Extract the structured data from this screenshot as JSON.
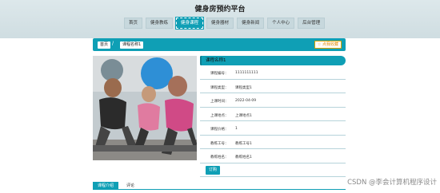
{
  "site_title": "健身房预约平台",
  "nav": [
    {
      "label": "首页"
    },
    {
      "label": "健身教练"
    },
    {
      "label": "健身课程"
    },
    {
      "label": "健身器材"
    },
    {
      "label": "健身新闻"
    },
    {
      "label": "个人中心"
    },
    {
      "label": "后台管理"
    }
  ],
  "breadcrumb": {
    "home": "首页",
    "separator": "/",
    "current": "课程名称1"
  },
  "favorite_label": "☆ 点我收藏",
  "info": {
    "title": "课程名称1",
    "rows": [
      {
        "label": "课程编号：",
        "value": "1111111111"
      },
      {
        "label": "课程类型：",
        "value": "课程类型1"
      },
      {
        "label": "上课时间：",
        "value": "2022-04-09"
      },
      {
        "label": "上课地点：",
        "value": "上课地点1"
      },
      {
        "label": "课程价格：",
        "value": "1"
      },
      {
        "label": "教练工号：",
        "value": "教练工号1"
      },
      {
        "label": "教练姓名：",
        "value": "教练姓名1"
      }
    ],
    "book_label": "订购"
  },
  "tabs": {
    "intro": "课程介绍",
    "comments": "评论"
  },
  "watermark": "CSDN @李会计算机程序设计",
  "colors": {
    "accent": "#0f9fb5",
    "header_bg": "#d5e2e6",
    "favorite": "#e08a00"
  }
}
